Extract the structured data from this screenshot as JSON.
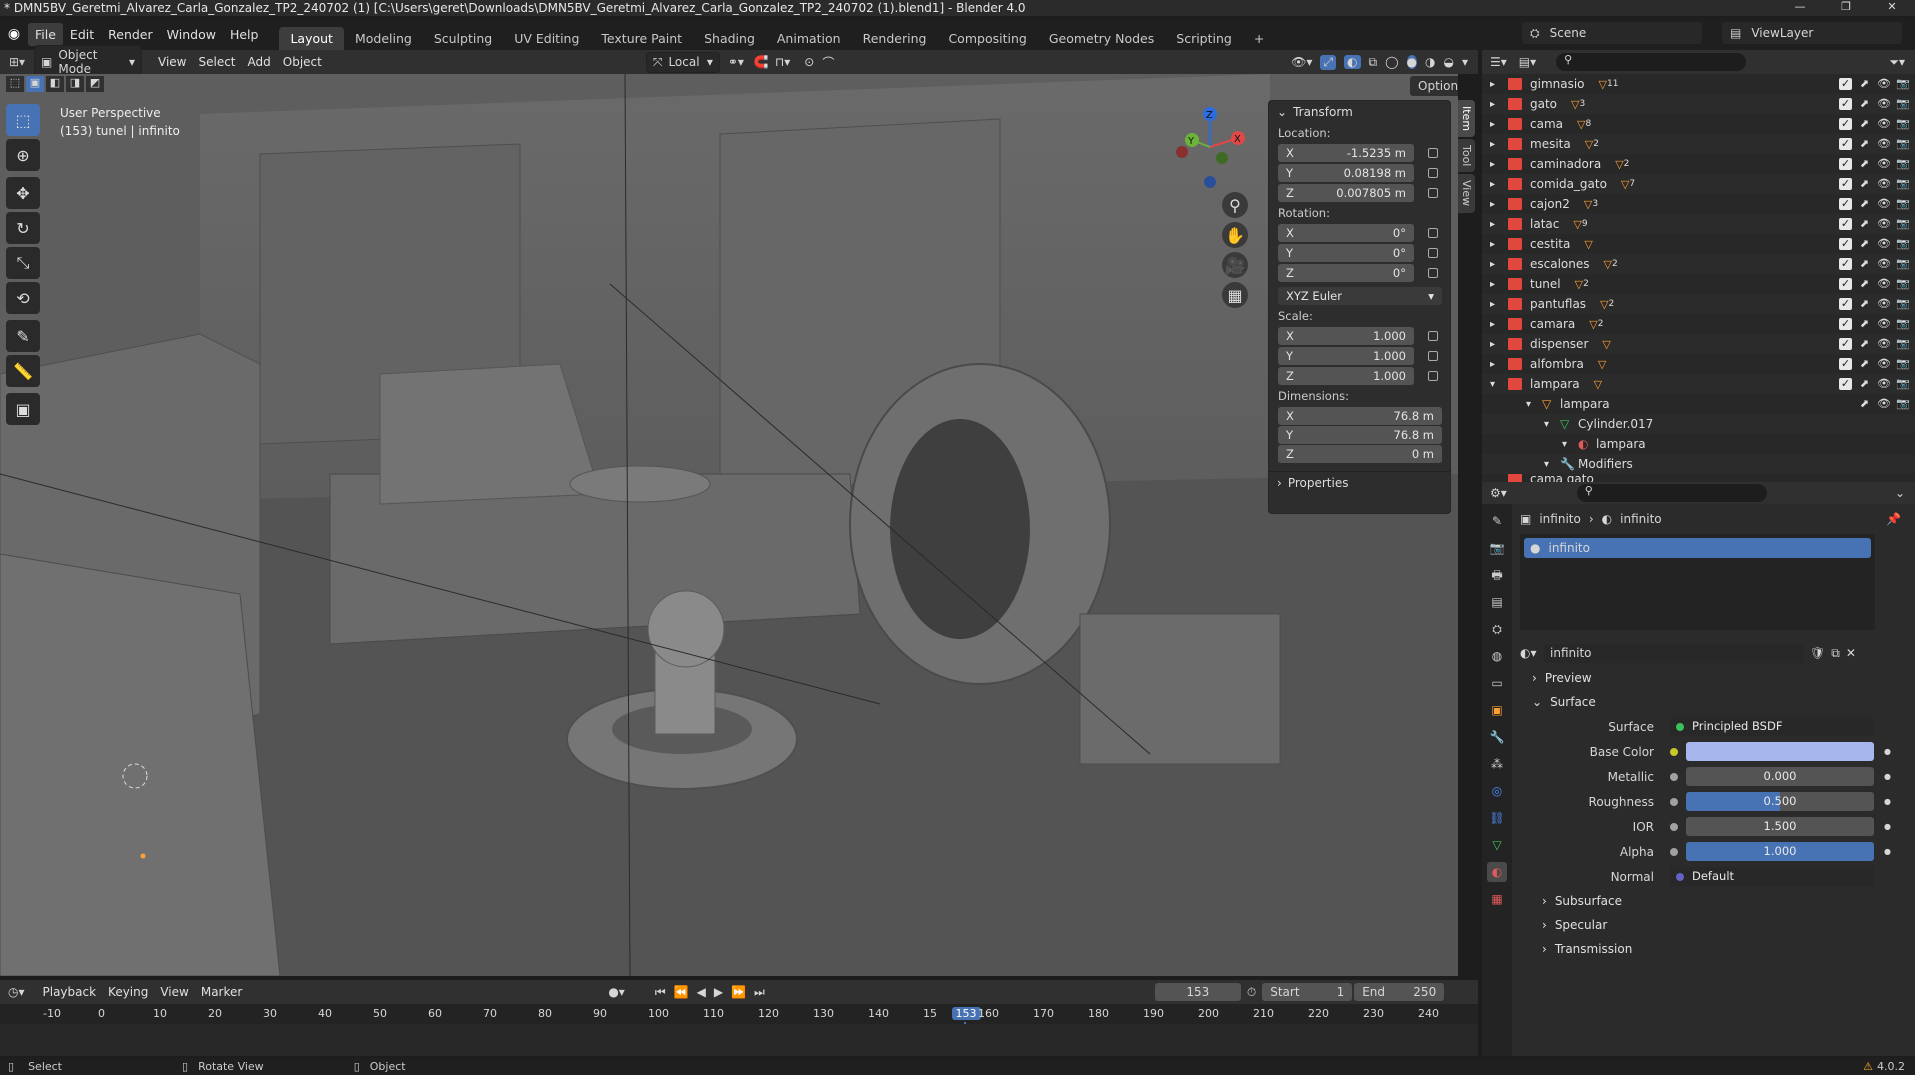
{
  "title_bar": {
    "title": "* DMN5BV_Geretmi_Alvarez_Carla_Gonzalez_TP2_240702 (1) [C:\\Users\\geret\\Downloads\\DMN5BV_Geretmi_Alvarez_Carla_Gonzalez_TP2_240702 (1).blend1] - Blender 4.0",
    "minimize": "—",
    "maximize": "❐",
    "close": "✕"
  },
  "menu": [
    "File",
    "Edit",
    "Render",
    "Window",
    "Help"
  ],
  "workspaces": [
    "Layout",
    "Modeling",
    "Sculpting",
    "UV Editing",
    "Texture Paint",
    "Shading",
    "Animation",
    "Rendering",
    "Compositing",
    "Geometry Nodes",
    "Scripting",
    "+"
  ],
  "scene": {
    "label": "Scene",
    "view_layer": "ViewLayer"
  },
  "viewport_header": {
    "mode": "Object Mode",
    "menus": [
      "View",
      "Select",
      "Add",
      "Object"
    ],
    "transform_orientation": "Local",
    "options": "Options"
  },
  "viewport": {
    "perspective": "User Perspective",
    "object_info": "(153) tunel | infinito"
  },
  "npanel": {
    "section": "Transform",
    "location_label": "Location:",
    "location": [
      {
        "axis": "X",
        "value": "-1.5235 m"
      },
      {
        "axis": "Y",
        "value": "0.08198 m"
      },
      {
        "axis": "Z",
        "value": "0.007805 m"
      }
    ],
    "rotation_label": "Rotation:",
    "rotation": [
      {
        "axis": "X",
        "value": "0°"
      },
      {
        "axis": "Y",
        "value": "0°"
      },
      {
        "axis": "Z",
        "value": "0°"
      }
    ],
    "rotation_mode": "XYZ Euler",
    "scale_label": "Scale:",
    "scale": [
      {
        "axis": "X",
        "value": "1.000"
      },
      {
        "axis": "Y",
        "value": "1.000"
      },
      {
        "axis": "Z",
        "value": "1.000"
      }
    ],
    "dimensions_label": "Dimensions:",
    "dimensions": [
      {
        "axis": "X",
        "value": "76.8 m"
      },
      {
        "axis": "Y",
        "value": "76.8 m"
      },
      {
        "axis": "Z",
        "value": "0 m"
      }
    ],
    "properties": "Properties",
    "tabs": [
      "Item",
      "Tool",
      "View"
    ]
  },
  "outliner": {
    "rows": [
      {
        "name": "gimnasio",
        "badge": "11"
      },
      {
        "name": "gato",
        "badge": "3"
      },
      {
        "name": "cama",
        "badge": "8"
      },
      {
        "name": "mesita",
        "badge": "2"
      },
      {
        "name": "caminadora",
        "badge": "2"
      },
      {
        "name": "comida_gato",
        "badge": "7"
      },
      {
        "name": "cajon2",
        "badge": "3"
      },
      {
        "name": "latac",
        "badge": "9"
      },
      {
        "name": "cestita",
        "badge": ""
      },
      {
        "name": "escalones",
        "badge": "2"
      },
      {
        "name": "tunel",
        "badge": "2"
      },
      {
        "name": "pantuflas",
        "badge": "2"
      },
      {
        "name": "camara",
        "badge": "2"
      },
      {
        "name": "dispenser",
        "badge": ""
      },
      {
        "name": "alfombra",
        "badge": ""
      },
      {
        "name": "lampara",
        "badge": ""
      }
    ],
    "children": [
      {
        "name": "lampara",
        "indent": 1
      },
      {
        "name": "Cylinder.017",
        "indent": 2
      },
      {
        "name": "lampara",
        "indent": 3
      },
      {
        "name": "Modifiers",
        "indent": 2
      }
    ],
    "cut_row": "cama gato"
  },
  "properties": {
    "breadcrumb": [
      "infinito",
      "infinito"
    ],
    "material_slot": "infinito",
    "material_name": "infinito",
    "preview": "Preview",
    "surface_section": "Surface",
    "surface_label": "Surface",
    "surface_value": "Principled BSDF",
    "fields": [
      {
        "label": "Base Color",
        "value": "",
        "fill": 1.0,
        "color": "#a7b7ee"
      },
      {
        "label": "Metallic",
        "value": "0.000",
        "fill": 0.0
      },
      {
        "label": "Roughness",
        "value": "0.500",
        "fill": 0.5
      },
      {
        "label": "IOR",
        "value": "1.500",
        "fill": 0.0
      },
      {
        "label": "Alpha",
        "value": "1.000",
        "fill": 1.0
      }
    ],
    "normal_label": "Normal",
    "normal_value": "Default",
    "subsections": [
      "Subsurface",
      "Specular",
      "Transmission"
    ]
  },
  "timeline": {
    "menus": [
      "Playback",
      "Keying",
      "View",
      "Marker"
    ],
    "current_frame": "153",
    "start_label": "Start",
    "start": "1",
    "end_label": "End",
    "end": "250",
    "ticks": [
      "-10",
      "0",
      "10",
      "20",
      "30",
      "40",
      "50",
      "60",
      "70",
      "80",
      "90",
      "100",
      "110",
      "120",
      "130",
      "140",
      "15",
      "153",
      "160",
      "170",
      "180",
      "190",
      "200",
      "210",
      "220",
      "230",
      "240"
    ]
  },
  "status_bar": {
    "select": "Select",
    "rotate": "Rotate View",
    "object": "Object",
    "version": "4.0.2"
  },
  "colors": {
    "accent": "#4772b3",
    "collection": "#e0483e",
    "mesh": "#ff9f34"
  }
}
